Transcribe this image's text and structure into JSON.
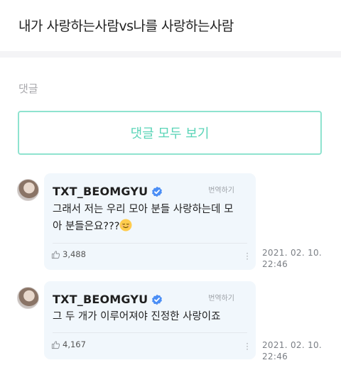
{
  "post": {
    "title": "내가 사랑하는사람vs나를 사랑하는사람"
  },
  "comments_section": {
    "label": "댓글",
    "view_all_label": "댓글 모두 보기"
  },
  "comments": [
    {
      "author": "TXT_BEOMGYU",
      "translate_label": "번역하기",
      "text_line1": "그래서 저는 우리 모아 분들 사랑하는데 모",
      "text_line2": "아 분들은요???",
      "emoji_icon": "relieved-face-emoji",
      "likes": "3,488",
      "date": "2021. 02. 10.",
      "time": "22:46"
    },
    {
      "author": "TXT_BEOMGYU",
      "translate_label": "번역하기",
      "text_line1": "그 두 개가 이루어져야 진정한 사랑이죠",
      "likes": "4,167",
      "date": "2021. 02. 10.",
      "time": "22:46"
    }
  ],
  "colors": {
    "accent": "#5ad4b7",
    "bubble": "#f1f7fc",
    "verified": "#4b8ef5"
  }
}
